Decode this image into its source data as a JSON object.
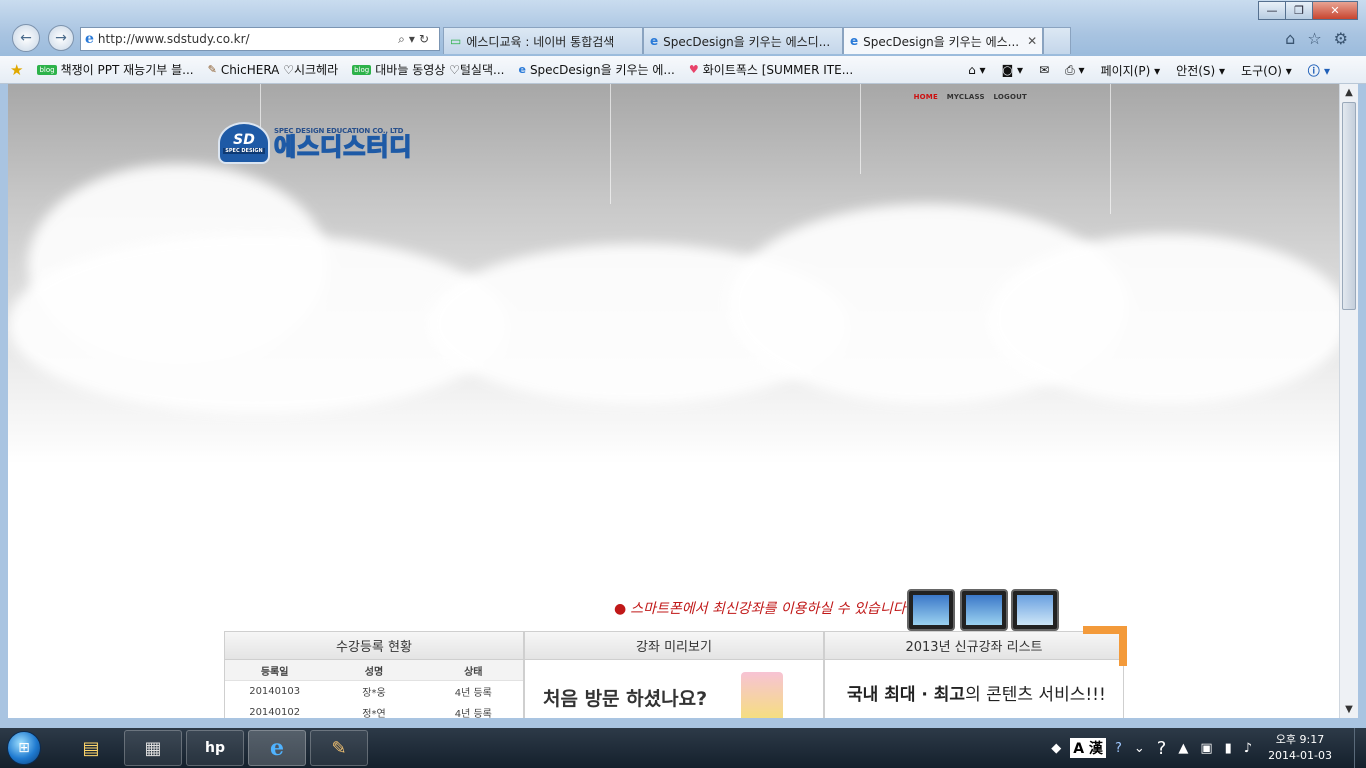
{
  "browser": {
    "address_url": "http://www.sdstudy.co.kr/",
    "tabs": [
      {
        "label": "에스디교육 : 네이버 통합검색",
        "icon": "naver-icon"
      },
      {
        "label": "SpecDesign을 키우는 에스디...",
        "icon": "ie-icon"
      },
      {
        "label": "SpecDesign을 키우는 에스...",
        "icon": "ie-icon"
      }
    ],
    "favorites": [
      {
        "label": "책쟁이 PPT 재능기부 블...",
        "badge": "blog"
      },
      {
        "label": "ChicHERA ♡시크헤라",
        "badge": ""
      },
      {
        "label": "대바늘 동영상 ♡털실댁...",
        "badge": "blog"
      },
      {
        "label": "SpecDesign을 키우는 에...",
        "badge": ""
      },
      {
        "label": "화이트폭스 [SUMMER ITE...",
        "badge": ""
      }
    ],
    "commands": {
      "page": "페이지(P)",
      "safety": "안전(S)",
      "tools": "도구(O)"
    }
  },
  "site": {
    "top_nav": {
      "home": "HOME",
      "myclass": "MYCLASS",
      "logout": "LOGOUT"
    },
    "logo": {
      "sub": "SPEC DESIGN EDUCATION CO., LTD",
      "main": "에스디스터디",
      "badge_big": "SD",
      "badge_small": "SPEC DESIGN"
    },
    "mobile_note": "스마트폰에서 최신강좌를 이용하실 수 있습니다.",
    "panels": {
      "registration": {
        "title": "수강등록 현황",
        "columns": [
          "등록일",
          "성명",
          "상태"
        ],
        "rows": [
          [
            "20140103",
            "장*웅",
            "4년 등록"
          ],
          [
            "20140102",
            "정*연",
            "4년 등록"
          ]
        ]
      },
      "preview": {
        "title": "강좌 미리보기",
        "headline": "처음 방문 하셨나요?"
      },
      "new_list": {
        "title": "2013년 신규강좌 리스트",
        "headline_a": "국내 최대 · 최고",
        "headline_b": "의 콘텐츠 서비스!!!"
      }
    }
  },
  "taskbar": {
    "ime": "A 漢",
    "time": "오후 9:17",
    "date": "2014-01-03"
  }
}
